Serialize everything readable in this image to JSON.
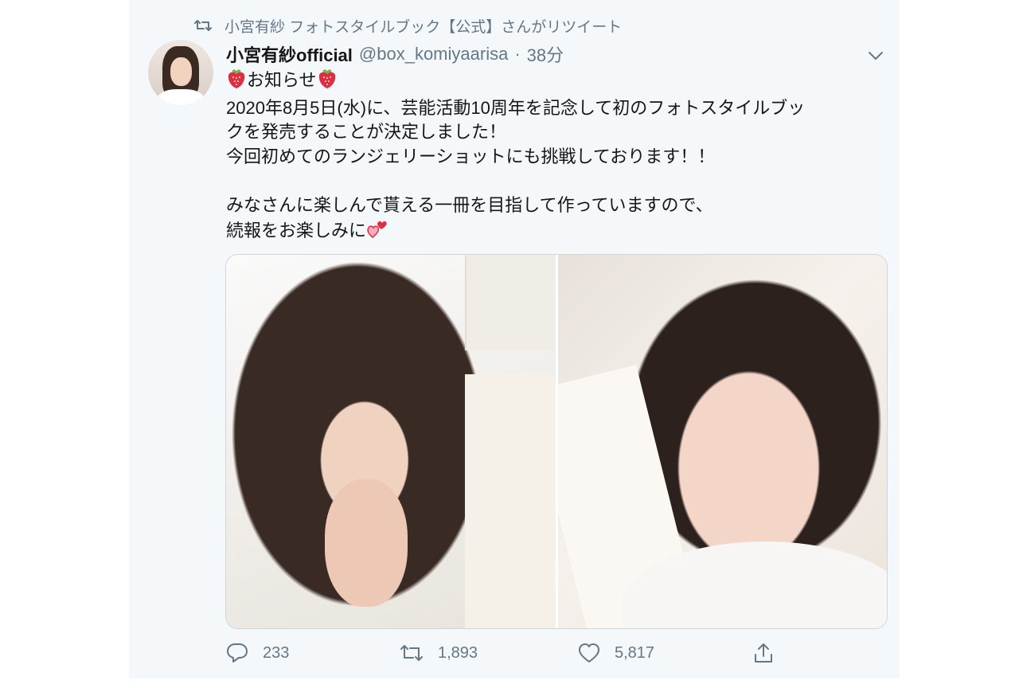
{
  "retweet_banner": {
    "icon": "retweet-icon",
    "text": "小宮有紗 フォトスタイルブック【公式】さんがリツイート"
  },
  "tweet": {
    "display_name": "小宮有紗official",
    "handle": "@box_komiyaarisa",
    "separator": "·",
    "time": "38分",
    "lines": [
      "お知らせ",
      "2020年8月5日(水)に、芸能活動10周年を記念して初のフォトスタイルブッ",
      "クを発売することが決定しました！",
      "今回初めてのランジェリーショットにも挑戦しております！！",
      "",
      "みなさんに楽しんで貰える一冊を目指して作っていますので、",
      "続報をお楽しみに"
    ],
    "emojis": [
      "strawberry-emoji",
      "strawberry-emoji",
      "two-hearts-emoji"
    ],
    "media": [
      {
        "icon": "photo-portrait-1"
      },
      {
        "icon": "photo-portrait-2"
      }
    ]
  },
  "actions": {
    "reply_count": "233",
    "retweet_count": "1,893",
    "like_count": "5,817"
  },
  "colors": {
    "background": "#f5f8fa",
    "text": "#14171a",
    "secondary": "#657786",
    "accent_heart": "#e0245e"
  }
}
